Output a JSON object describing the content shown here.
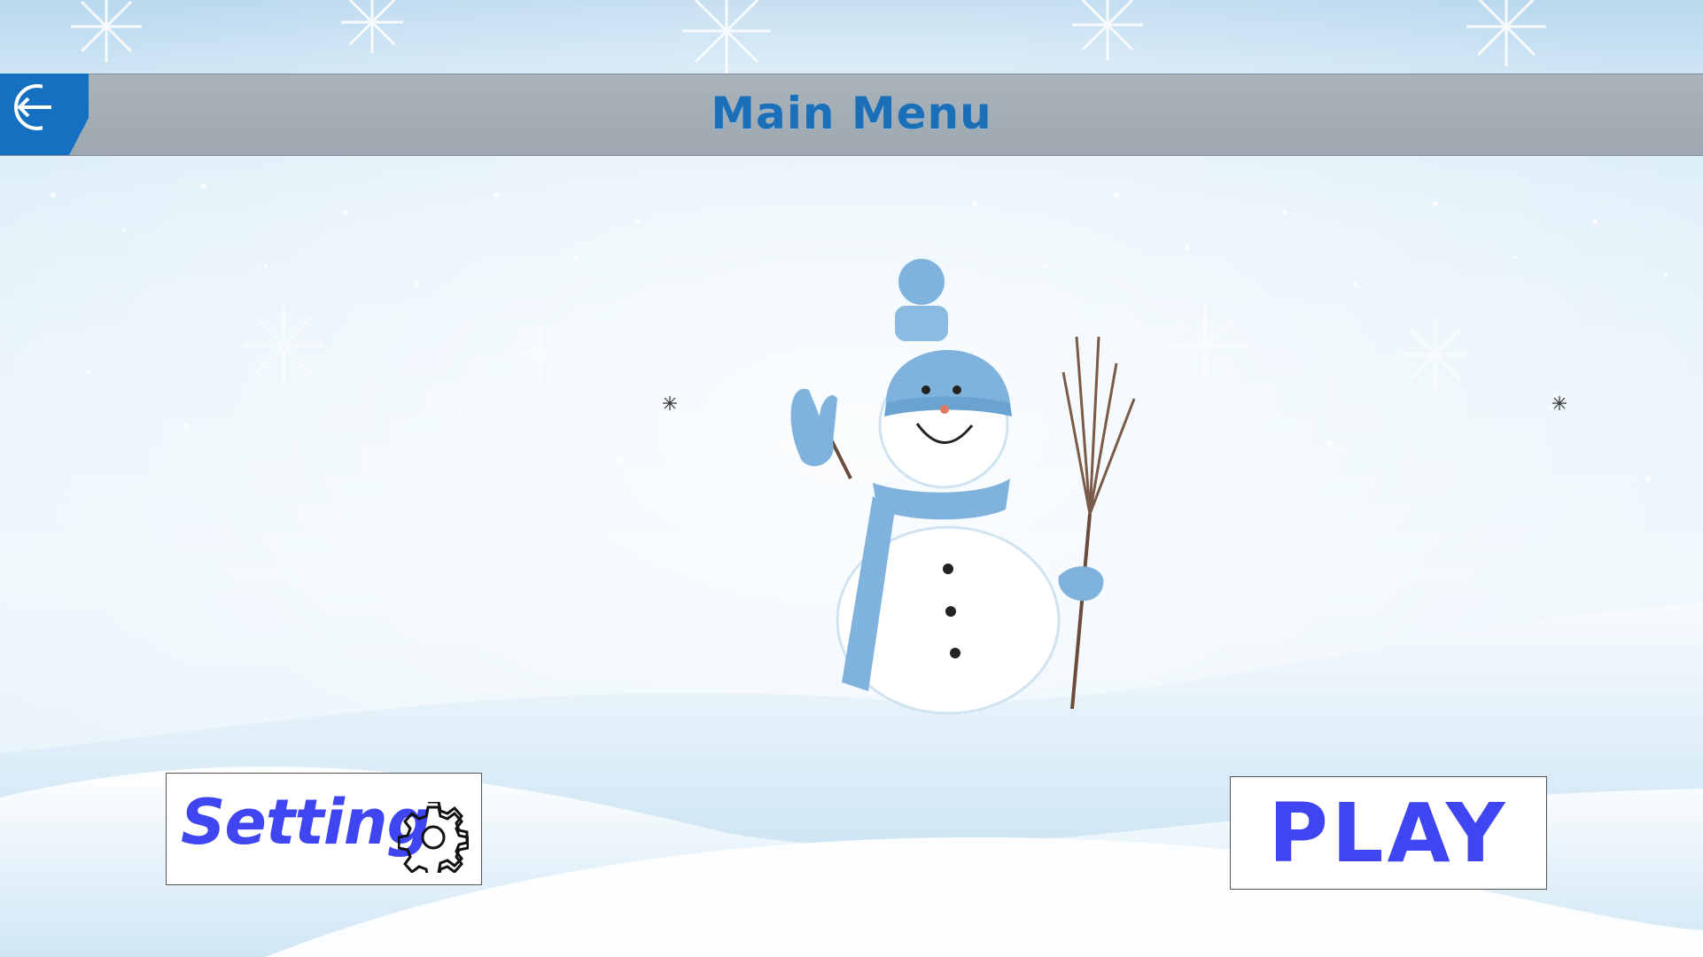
{
  "header": {
    "title": "Main Menu",
    "back_icon": "exit-arrow-icon"
  },
  "menu": {
    "setting_label": "Setting",
    "setting_icon": "gear-icon",
    "play_label": "PLAY"
  },
  "colors": {
    "title": "#1b6fb8",
    "button_text": "#3f45f0",
    "back_button_bg": "#1570c2",
    "header_bar": "#a3adb5"
  }
}
